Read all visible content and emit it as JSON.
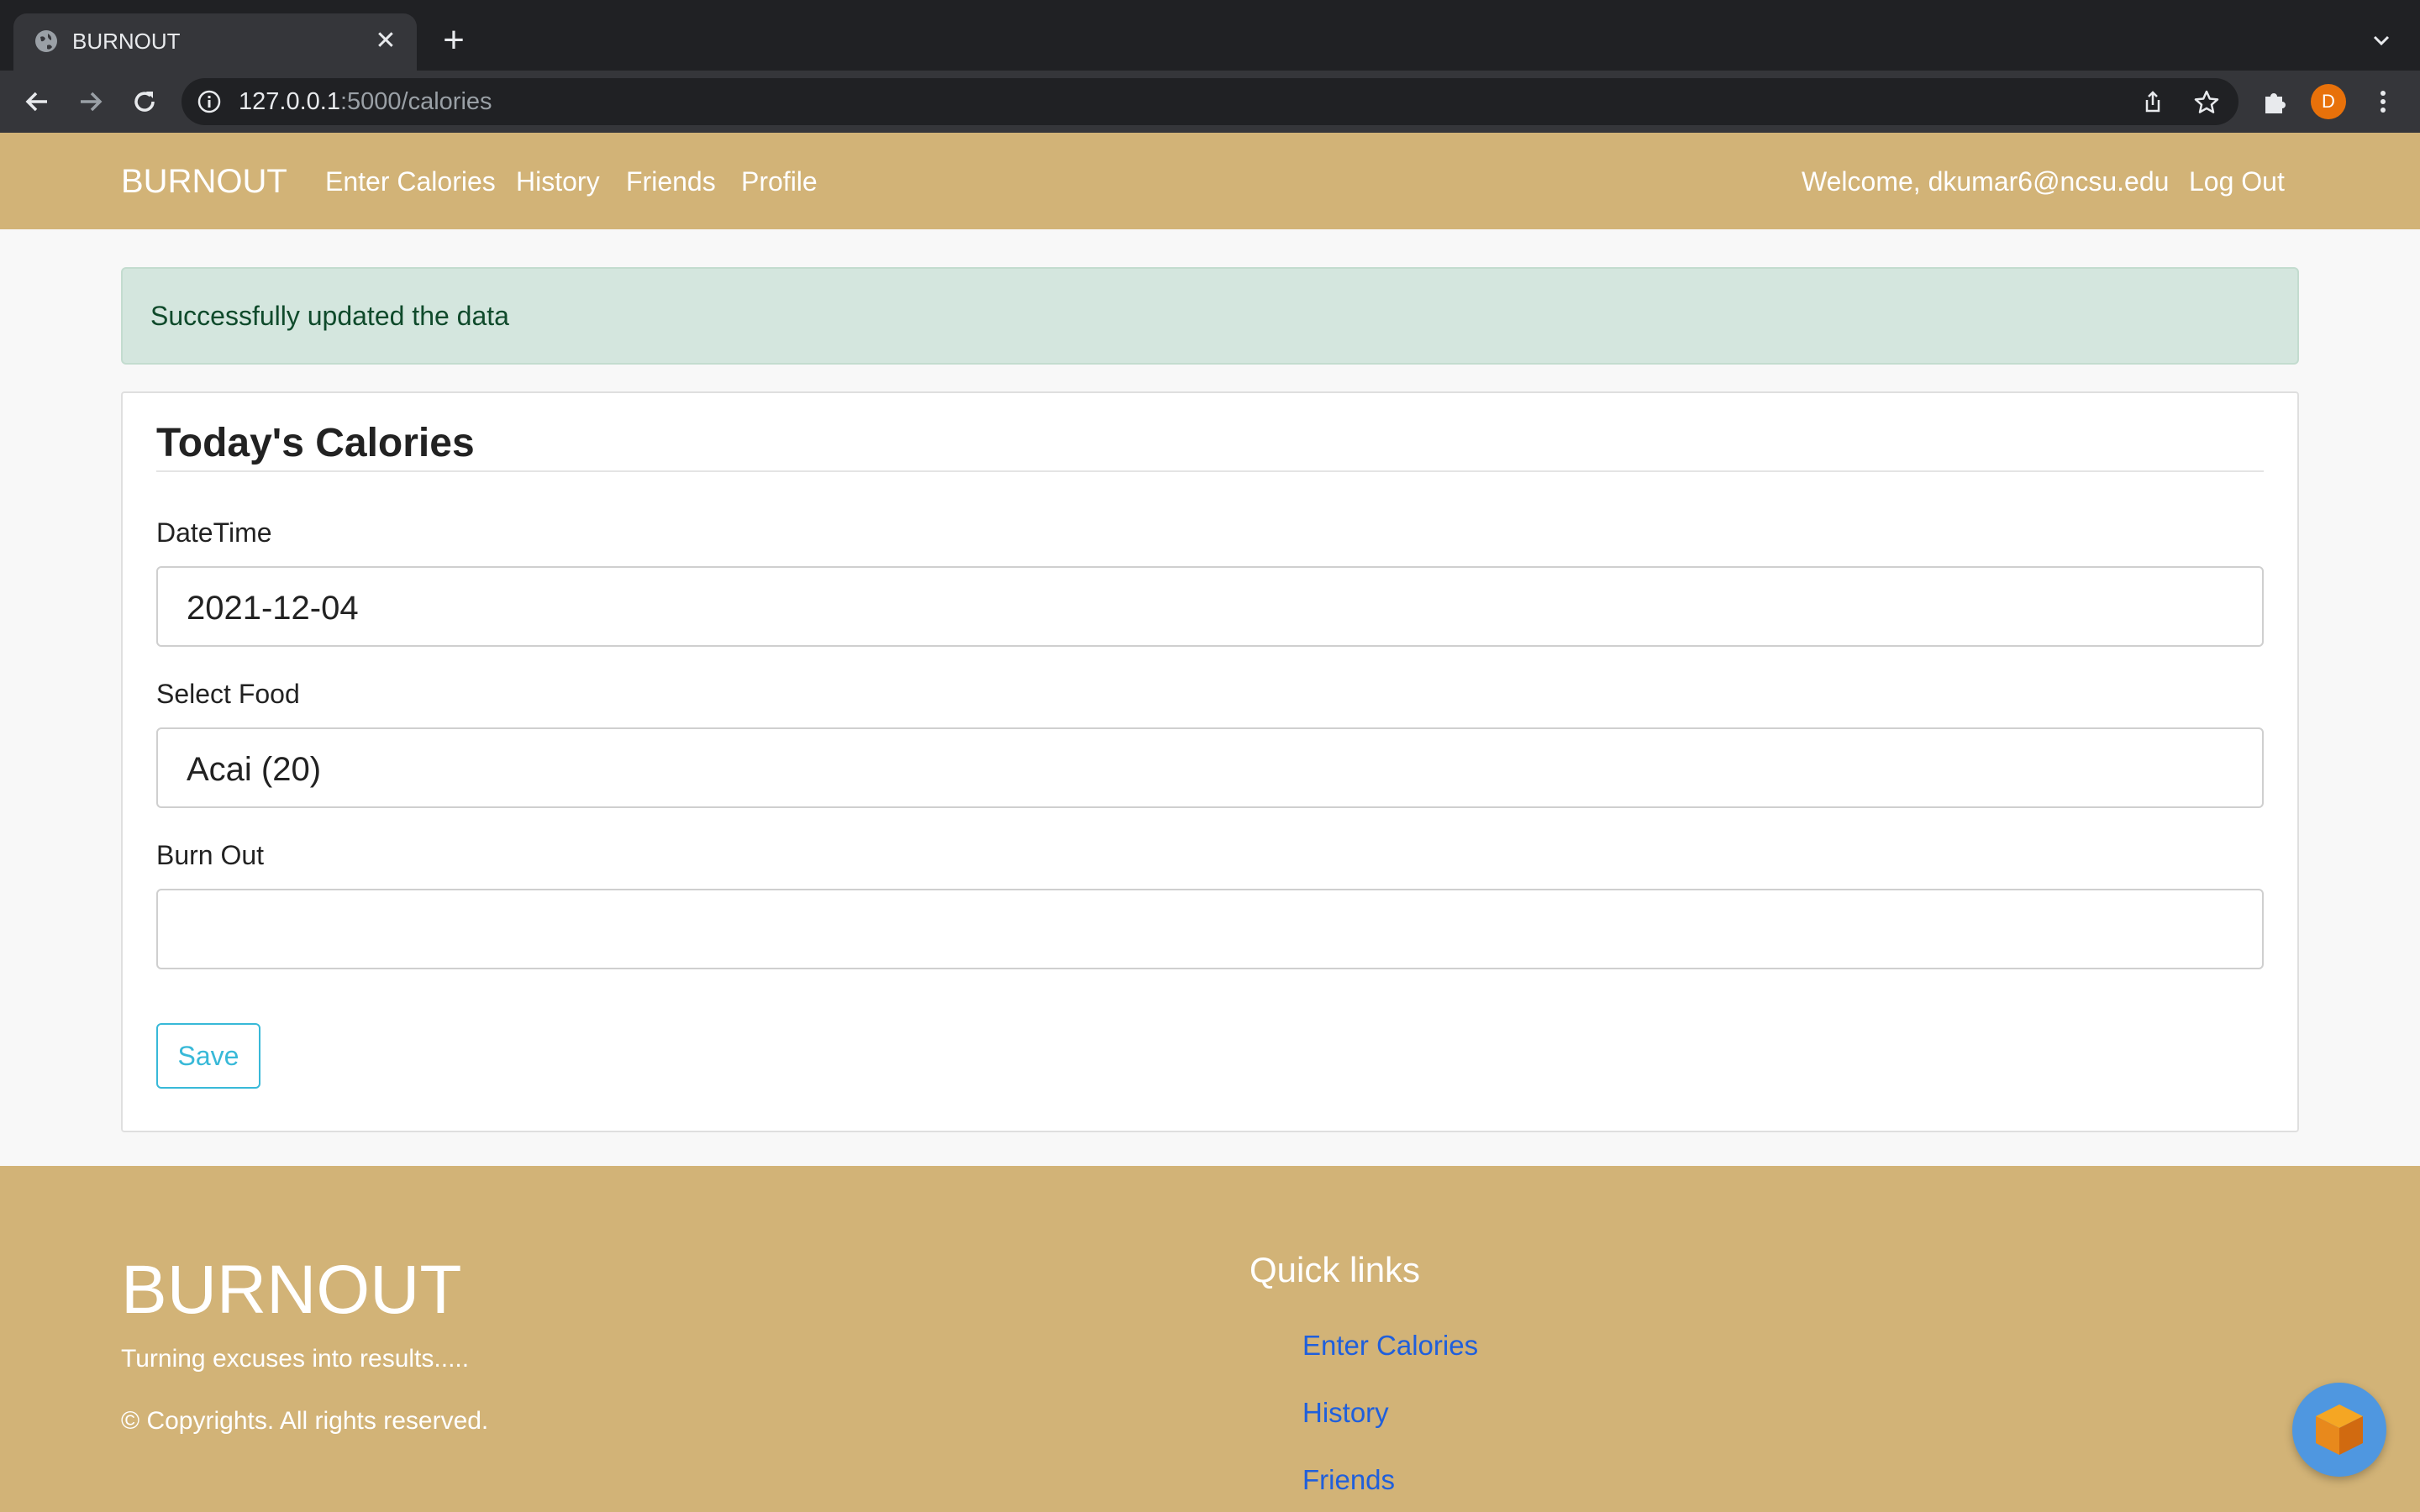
{
  "browser": {
    "tab_title": "BURNOUT",
    "url_host": "127.0.0.1",
    "url_path": ":5000/calories",
    "avatar_letter": "D",
    "icons": [
      "globe-icon",
      "close-icon",
      "plus-icon",
      "chevron-down-icon",
      "back-icon",
      "forward-icon",
      "reload-icon",
      "info-icon",
      "share-icon",
      "star-icon",
      "puzzle-icon",
      "menu-icon"
    ]
  },
  "navbar": {
    "brand": "BURNOUT",
    "links": [
      "Enter Calories",
      "History",
      "Friends",
      "Profile"
    ],
    "welcome": "Welcome, dkumar6@ncsu.edu",
    "logout": "Log Out"
  },
  "alert": {
    "message": "Successfully updated the data"
  },
  "form": {
    "title": "Today's Calories",
    "date_label": "DateTime",
    "date_value": "2021-12-04",
    "food_label": "Select Food",
    "food_value": "Acai (20)",
    "burnout_label": "Burn Out",
    "burnout_value": "",
    "save_label": "Save"
  },
  "footer": {
    "brand": "BURNOUT",
    "tagline": "Turning excuses into results.....",
    "copyright": "© Copyrights. All rights reserved.",
    "quick_links_heading": "Quick links",
    "quick_links": [
      "Enter Calories",
      "History",
      "Friends"
    ]
  },
  "colors": {
    "brand": "#d2b377",
    "alert_bg": "#d4e6de",
    "alert_text": "#0f4a2b",
    "button_accent": "#38b9d8",
    "link": "#1f5fdc",
    "fab": "#4f97e0"
  }
}
